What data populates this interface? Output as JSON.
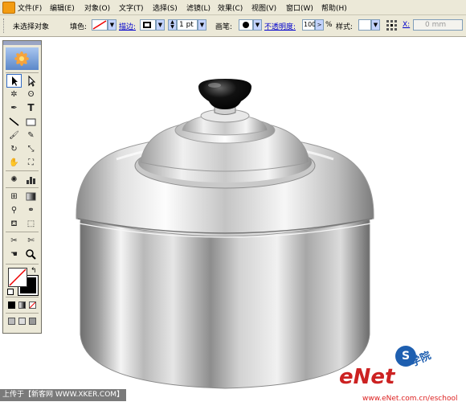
{
  "menubar": {
    "items": [
      "文件(F)",
      "编辑(E)",
      "对象(O)",
      "文字(T)",
      "选择(S)",
      "滤镜(L)",
      "效果(C)",
      "视图(V)",
      "窗口(W)",
      "帮助(H)"
    ]
  },
  "controlbar": {
    "selection_status": "未选择对象",
    "fill_label": "填色:",
    "stroke_link": "描边:",
    "stroke_weight": "1 pt",
    "brush_label": "画笔:",
    "opacity_link": "不透明度:",
    "opacity_value": "100",
    "opacity_unit": "%",
    "style_label": "样式:",
    "x_label": "X:",
    "x_value": "0 mm"
  },
  "footer": {
    "left_text": "上传于【新客网 WWW.XKER.COM】",
    "right_url": "www.eNet.com.cn/eschool",
    "brand_e": "eNet",
    "brand_cn": "学院"
  },
  "colors": {
    "chrome_bg": "#ece9d8",
    "link_blue": "#0000cc",
    "brand_red": "#cc2222",
    "brand_blue": "#1e5fb0"
  },
  "icons": {
    "tools": [
      "selection-tool",
      "direct-selection-tool",
      "magic-wand-tool",
      "lasso-tool",
      "pen-tool",
      "type-tool",
      "line-segment-tool",
      "rectangle-tool",
      "paintbrush-tool",
      "pencil-tool",
      "rotate-tool",
      "scale-tool",
      "warp-tool",
      "free-transform-tool",
      "symbol-sprayer-tool",
      "graph-tool",
      "mesh-tool",
      "gradient-tool",
      "eyedropper-tool",
      "blend-tool",
      "live-paint-bucket-tool",
      "live-paint-selection-tool",
      "slice-tool",
      "scissors-tool",
      "hand-tool",
      "zoom-tool"
    ]
  }
}
